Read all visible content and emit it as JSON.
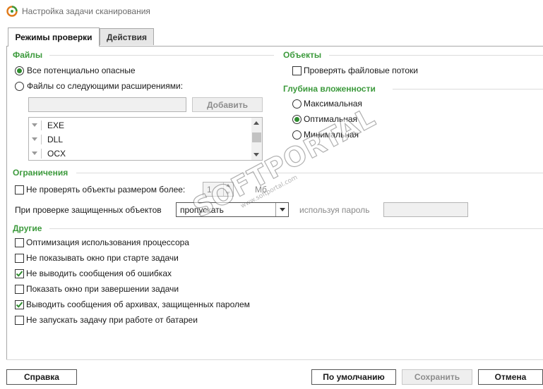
{
  "window": {
    "title": "Настройка задачи сканирования"
  },
  "tabs": [
    {
      "label": "Режимы проверки",
      "active": true
    },
    {
      "label": "Действия",
      "active": false
    }
  ],
  "files": {
    "header": "Файлы",
    "radio_all": "Все потенциально опасные",
    "radio_ext": "Файлы со следующими расширениями:",
    "add_button": "Добавить",
    "extensions": [
      "EXE",
      "DLL",
      "OCX"
    ]
  },
  "objects": {
    "header": "Объекты",
    "check_streams": "Проверять файловые потоки"
  },
  "depth": {
    "header": "Глубина вложенности",
    "options": [
      "Максимальная",
      "Оптимальная",
      "Минимальная"
    ],
    "selected": "Оптимальная"
  },
  "limits": {
    "header": "Ограничения",
    "size_label": "Не проверять объекты размером более:",
    "size_value": "1",
    "size_unit": "Мб",
    "protected_label": "При проверке защищенных объектов",
    "protected_value": "пропускать",
    "password_label": "используя пароль"
  },
  "other": {
    "header": "Другие",
    "items": [
      {
        "label": "Оптимизация использования процессора",
        "checked": false
      },
      {
        "label": "Не показывать окно при старте задачи",
        "checked": false
      },
      {
        "label": "Не выводить сообщения об ошибках",
        "checked": true
      },
      {
        "label": "Показать окно при завершении задачи",
        "checked": false
      },
      {
        "label": "Выводить сообщения об архивах, защищенных паролем",
        "checked": true
      },
      {
        "label": "Не запускать задачу при работе от батареи",
        "checked": false
      }
    ]
  },
  "footer": {
    "help": "Справка",
    "defaults": "По умолчанию",
    "save": "Сохранить",
    "cancel": "Отмена"
  },
  "watermark": {
    "text": "SOFTPORTAL",
    "sub": "www.softportal.com",
    "tm": "TM"
  },
  "colors": {
    "accent_green": "#3c9a3c",
    "check_green": "#2f8d2f"
  }
}
